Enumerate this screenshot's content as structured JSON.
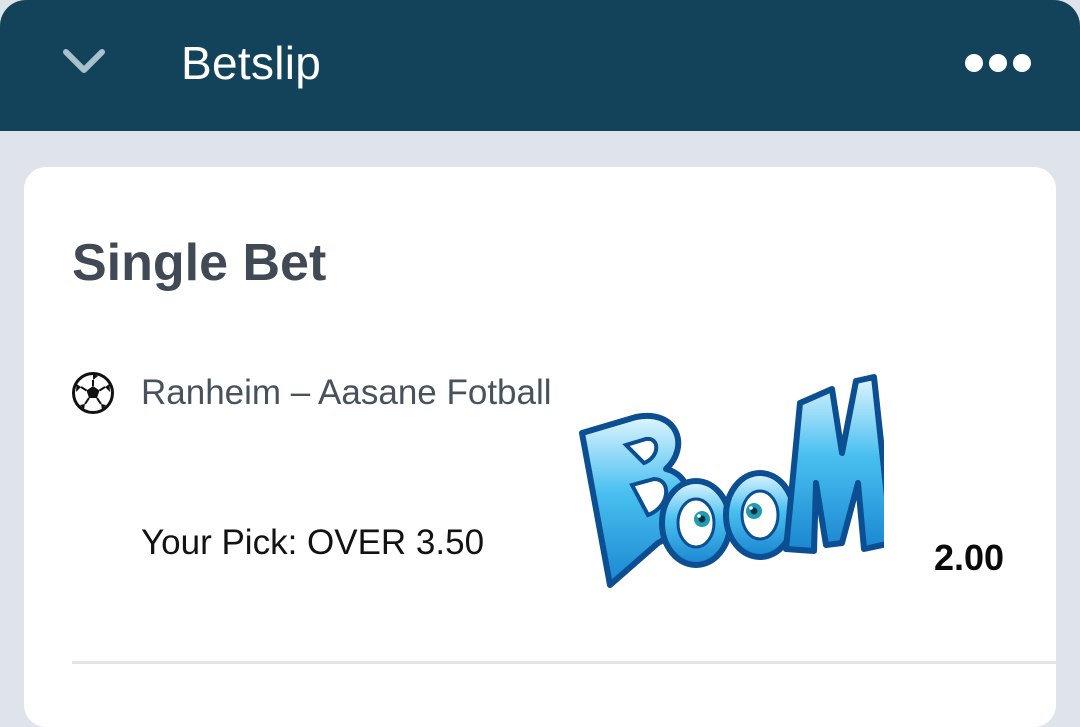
{
  "header": {
    "title": "Betslip",
    "back_icon": "chevron-down-icon",
    "menu_icon": "more-dots-icon",
    "background": "#13435a"
  },
  "bet": {
    "type_label": "Single Bet",
    "sport_icon": "soccer-ball-icon",
    "event": "Ranheim – Aasane Fotball",
    "pick": "Your Pick: OVER 3.50",
    "odds": "2.00"
  },
  "sticker": {
    "text": "BOOM",
    "colors": {
      "fill": "#34b6ec",
      "outline": "#0e5aa3"
    }
  }
}
